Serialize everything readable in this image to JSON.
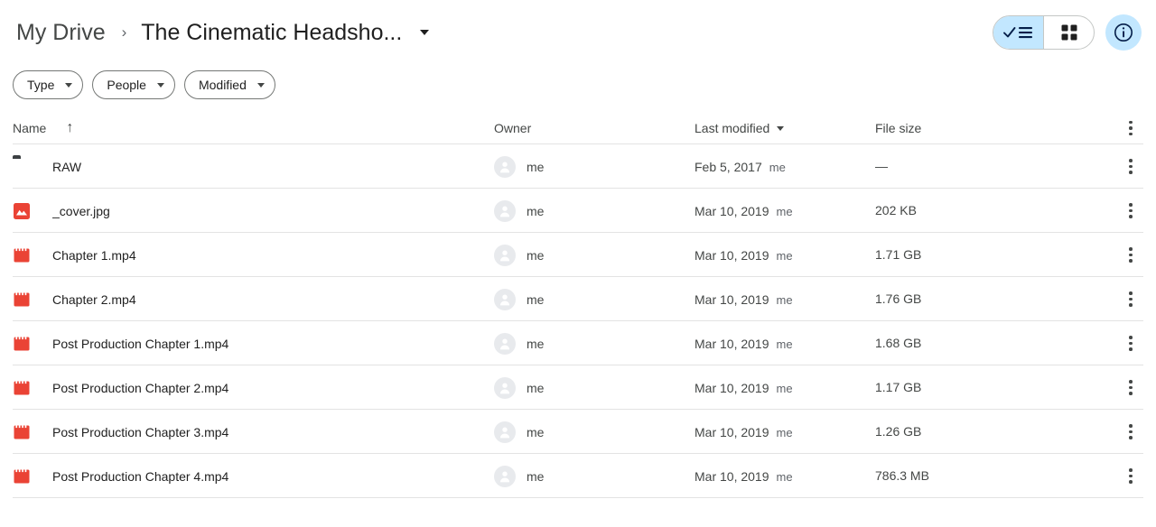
{
  "breadcrumb": {
    "root": "My Drive",
    "separator": "›",
    "current": "The Cinematic Headsho...",
    "caret_icon": "chevron-down-icon"
  },
  "toolbar": {
    "list_view_label": "list-view",
    "grid_view_label": "grid-view",
    "info_label": "info",
    "icons": {
      "list": "check-list-icon",
      "grid": "grid-icon",
      "info": "info-circle-icon"
    },
    "active_accent": "#c2e7ff"
  },
  "filters": [
    {
      "label": "Type",
      "name": "filter-chip-type"
    },
    {
      "label": "People",
      "name": "filter-chip-people"
    },
    {
      "label": "Modified",
      "name": "filter-chip-modified"
    }
  ],
  "table": {
    "columns": {
      "name": "Name",
      "sort_arrow": "↑",
      "owner": "Owner",
      "last_modified": "Last modified",
      "file_size": "File size"
    },
    "rows": [
      {
        "icon": "folder-icon",
        "icon_color": "#3c4043",
        "name": "RAW",
        "owner": "me",
        "modified_date": "Feb 5, 2017",
        "modified_by": "me",
        "size": "—"
      },
      {
        "icon": "image-file-icon",
        "icon_color": "#ea4335",
        "name": "_cover.jpg",
        "owner": "me",
        "modified_date": "Mar 10, 2019",
        "modified_by": "me",
        "size": "202 KB"
      },
      {
        "icon": "video-file-icon",
        "icon_color": "#ea4335",
        "name": "Chapter 1.mp4",
        "owner": "me",
        "modified_date": "Mar 10, 2019",
        "modified_by": "me",
        "size": "1.71 GB"
      },
      {
        "icon": "video-file-icon",
        "icon_color": "#ea4335",
        "name": "Chapter 2.mp4",
        "owner": "me",
        "modified_date": "Mar 10, 2019",
        "modified_by": "me",
        "size": "1.76 GB"
      },
      {
        "icon": "video-file-icon",
        "icon_color": "#ea4335",
        "name": "Post Production Chapter 1.mp4",
        "owner": "me",
        "modified_date": "Mar 10, 2019",
        "modified_by": "me",
        "size": "1.68 GB"
      },
      {
        "icon": "video-file-icon",
        "icon_color": "#ea4335",
        "name": "Post Production Chapter 2.mp4",
        "owner": "me",
        "modified_date": "Mar 10, 2019",
        "modified_by": "me",
        "size": "1.17 GB"
      },
      {
        "icon": "video-file-icon",
        "icon_color": "#ea4335",
        "name": "Post Production Chapter 3.mp4",
        "owner": "me",
        "modified_date": "Mar 10, 2019",
        "modified_by": "me",
        "size": "1.26 GB"
      },
      {
        "icon": "video-file-icon",
        "icon_color": "#ea4335",
        "name": "Post Production Chapter 4.mp4",
        "owner": "me",
        "modified_date": "Mar 10, 2019",
        "modified_by": "me",
        "size": "786.3 MB"
      }
    ]
  }
}
